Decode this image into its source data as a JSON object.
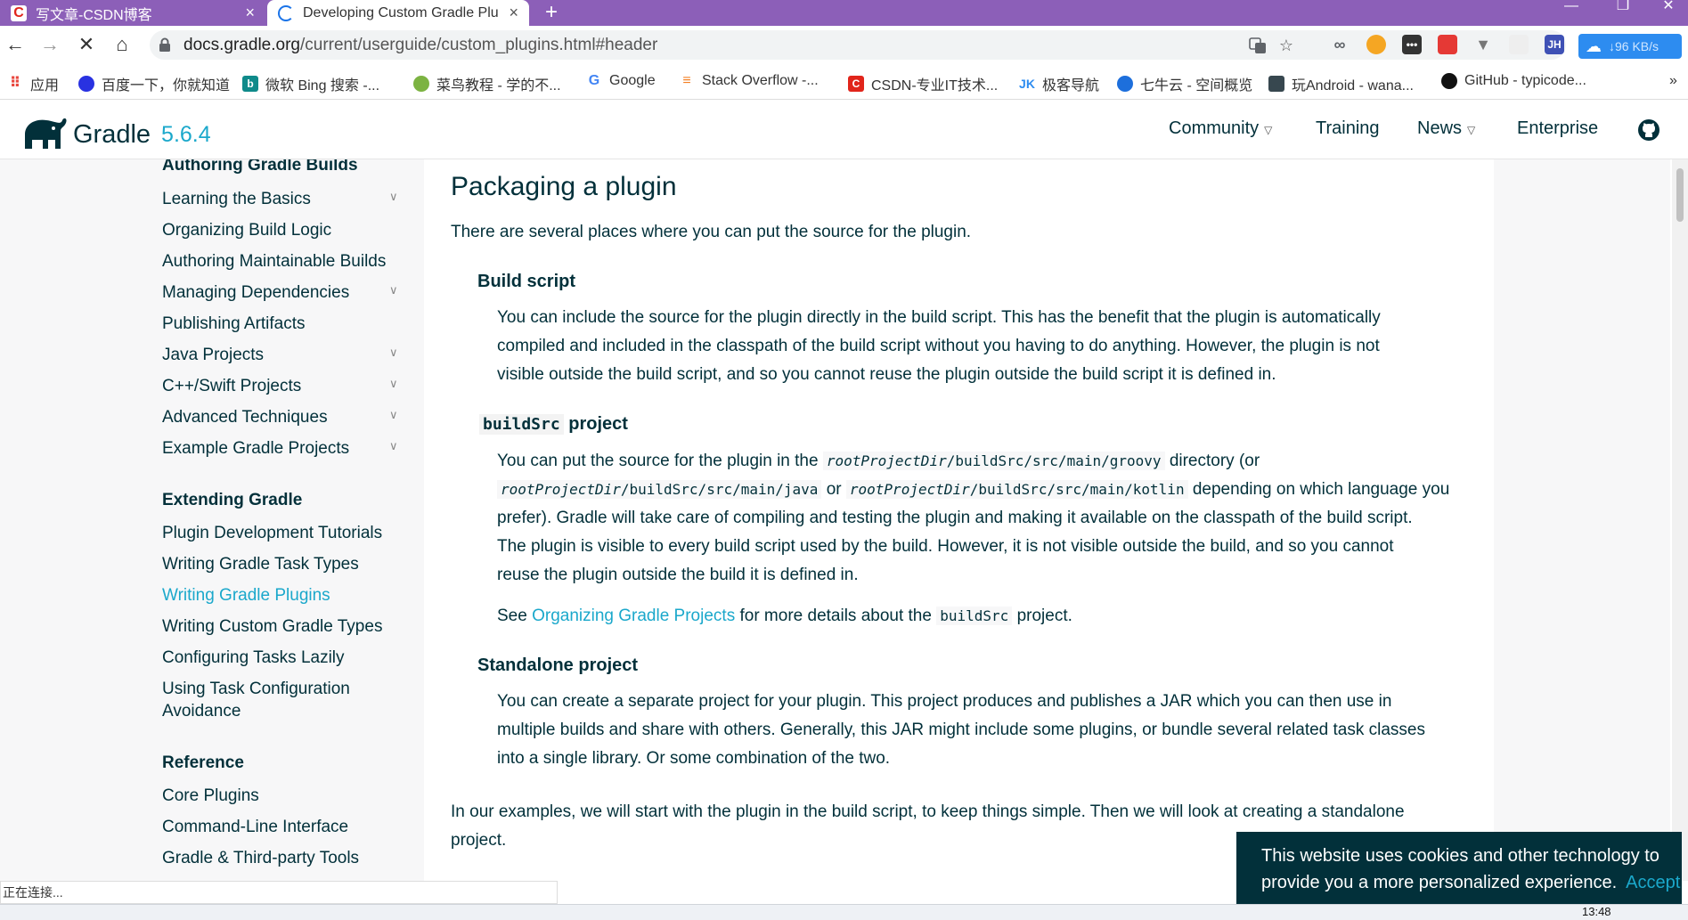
{
  "browser": {
    "tabs": [
      {
        "title": "写文章-CSDN博客",
        "close": "×",
        "active": false
      },
      {
        "title": "Developing Custom Gradle Plu",
        "close": "×",
        "active": true
      }
    ],
    "new_tab": "+",
    "window_controls": {
      "minimize": "—",
      "maximize": "❐",
      "close": "✕"
    },
    "nav": {
      "back": "←",
      "forward": "→",
      "reload": "✕",
      "home": "⌂"
    },
    "url": {
      "host": "docs.gradle.org",
      "path": "/current/userguide/custom_plugins.html#header"
    },
    "extensions": [
      "JH"
    ],
    "net_speed": "↓96 KB/s",
    "bookmarks": [
      {
        "label": "应用",
        "icon": "apps-grid-icon",
        "color": "#e8453c"
      },
      {
        "label": "百度一下，你就知道",
        "icon": "baidu-paw-icon",
        "color": "#2932e1"
      },
      {
        "label": "微软 Bing 搜索 -...",
        "icon": "bing-icon",
        "color": "#0f8a8a"
      },
      {
        "label": "菜鸟教程 - 学的不...",
        "icon": "runoob-icon",
        "color": "#7cb342"
      },
      {
        "label": "Google",
        "icon": "google-icon",
        "color": "#4285f4"
      },
      {
        "label": "Stack Overflow -...",
        "icon": "stackoverflow-icon",
        "color": "#f48024"
      },
      {
        "label": "CSDN-专业IT技术...",
        "icon": "csdn-icon",
        "color": "#e1251b"
      },
      {
        "label": "极客导航",
        "icon": "jk-icon",
        "color": "#2d8cf0"
      },
      {
        "label": "七牛云 - 空间概览",
        "icon": "qiniu-icon",
        "color": "#1d6fdc"
      },
      {
        "label": "玩Android - wana...",
        "icon": "android-icon",
        "color": "#37474f"
      },
      {
        "label": "GitHub - typicode...",
        "icon": "github-icon",
        "color": "#111111"
      }
    ],
    "more_bookmarks": "»"
  },
  "site": {
    "brand": "Gradle",
    "version": "5.6.4",
    "nav": [
      {
        "label": "Community",
        "dropdown": true
      },
      {
        "label": "Training",
        "dropdown": false
      },
      {
        "label": "News",
        "dropdown": true
      },
      {
        "label": "Enterprise",
        "dropdown": false
      }
    ],
    "accent": "#1ba8cb",
    "text_color": "#02303a"
  },
  "sidebar": {
    "sections": [
      {
        "heading": "Authoring Gradle Builds",
        "items": [
          {
            "label": "Learning the Basics",
            "expandable": true
          },
          {
            "label": "Organizing Build Logic",
            "expandable": false
          },
          {
            "label": "Authoring Maintainable Builds",
            "expandable": false
          },
          {
            "label": "Managing Dependencies",
            "expandable": true
          },
          {
            "label": "Publishing Artifacts",
            "expandable": false
          },
          {
            "label": "Java Projects",
            "expandable": true
          },
          {
            "label": "C++/Swift Projects",
            "expandable": true
          },
          {
            "label": "Advanced Techniques",
            "expandable": true
          },
          {
            "label": "Example Gradle Projects",
            "expandable": true
          }
        ]
      },
      {
        "heading": "Extending Gradle",
        "items": [
          {
            "label": "Plugin Development Tutorials",
            "expandable": false
          },
          {
            "label": "Writing Gradle Task Types",
            "expandable": false
          },
          {
            "label": "Writing Gradle Plugins",
            "expandable": false,
            "active": true
          },
          {
            "label": "Writing Custom Gradle Types",
            "expandable": false
          },
          {
            "label": "Configuring Tasks Lazily",
            "expandable": false
          },
          {
            "label": "Using Task Configuration",
            "expandable": false
          },
          {
            "label": "Avoidance",
            "expandable": false
          }
        ]
      },
      {
        "heading": "Reference",
        "items": [
          {
            "label": "Core Plugins",
            "expandable": false
          },
          {
            "label": "Command-Line Interface",
            "expandable": false
          },
          {
            "label": "Gradle & Third-party Tools",
            "expandable": false
          }
        ]
      }
    ]
  },
  "article": {
    "title": "Packaging a plugin",
    "intro": "There are several places where you can put the source for the plugin.",
    "build_script": {
      "heading": "Build script",
      "lines": [
        "You can include the source for the plugin directly in the build script. This has the benefit that the plugin is automatically",
        "compiled and included in the classpath of the build script without you having to do anything. However, the plugin is not",
        "visible outside the build script, and so you cannot reuse the plugin outside the build script it is defined in."
      ]
    },
    "buildsrc": {
      "heading_code": "buildSrc",
      "heading_text": "project",
      "l1_a": "You can put the source for the plugin in the",
      "l1_code_var": "rootProjectDir",
      "l1_code_path": "/buildSrc/src/main/groovy",
      "l1_b": "directory (or",
      "l2_code1_var": "rootProjectDir",
      "l2_code1_path": "/buildSrc/src/main/java",
      "l2_or": "or",
      "l2_code2_var": "rootProjectDir",
      "l2_code2_path": "/buildSrc/src/main/kotlin",
      "l2_b": "depending on which language you",
      "lines": [
        "prefer). Gradle will take care of compiling and testing the plugin and making it available on the classpath of the build script.",
        "The plugin is visible to every build script used by the build. However, it is not visible outside the build, and so you cannot",
        "reuse the plugin outside the build it is defined in."
      ],
      "see_a": "See",
      "see_link": "Organizing Gradle Projects",
      "see_b": "for more details about the",
      "see_code": "buildSrc",
      "see_c": "project."
    },
    "standalone": {
      "heading": "Standalone project",
      "lines": [
        "You can create a separate project for your plugin. This project produces and publishes a JAR which you can then use in",
        "multiple builds and share with others. Generally, this JAR might include some plugins, or bundle several related task classes",
        "into a single library. Or some combination of the two."
      ]
    },
    "outro": [
      "In our examples, we will start with the plugin in the build script, to keep things simple. Then we will look at creating a standalone",
      "project."
    ]
  },
  "cookie_banner": {
    "line1": "This website uses cookies and other technology to",
    "line2": "provide you a more personalized experience.",
    "accept": "Accept"
  },
  "status_bar": "正在连接...",
  "taskbar": {
    "clock": "13:48"
  }
}
